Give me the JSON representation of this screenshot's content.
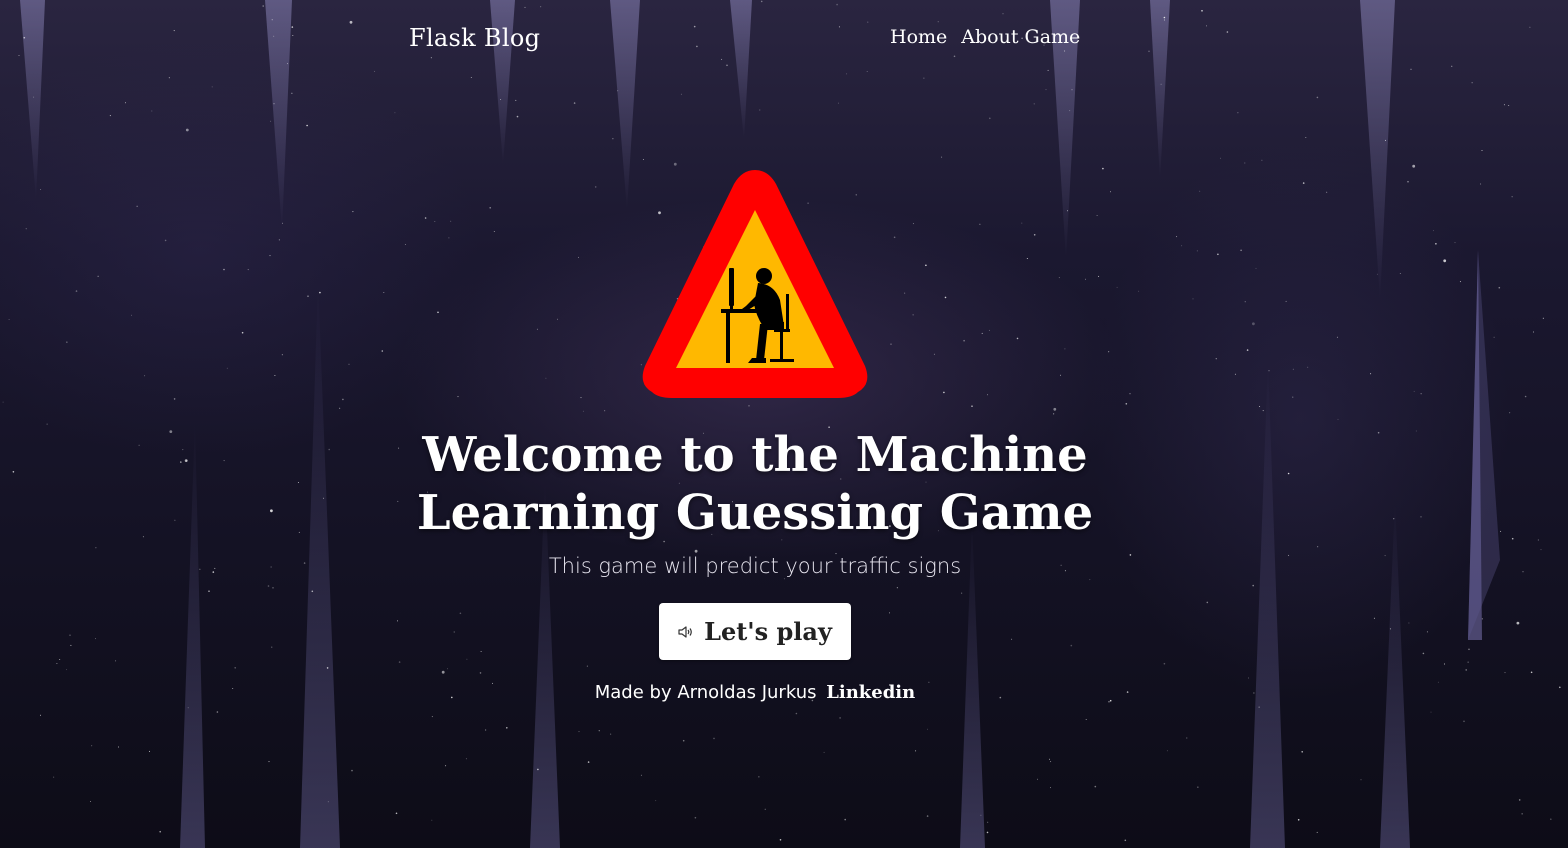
{
  "nav": {
    "brand": "Flask Blog",
    "links": [
      "Home",
      "About Game"
    ]
  },
  "hero": {
    "title_line1": "Welcome to the Machine",
    "title_line2": "Learning Guessing Game",
    "subtitle": "This game will predict your traffic signs",
    "play_button_label": "Let's play",
    "play_button_icon": "speaker-icon",
    "credits_text": "Made by Arnoldas Jurkus",
    "credits_link": "Linkedin"
  },
  "sign": {
    "icon": "warning-programmer-sign-icon",
    "border_color": "#ff0000",
    "fill_color": "#ffb800",
    "figure_color": "#000000"
  },
  "colors": {
    "background": "#141224",
    "text": "#ffffff",
    "button_bg": "#ffffff",
    "button_text": "#222222"
  }
}
